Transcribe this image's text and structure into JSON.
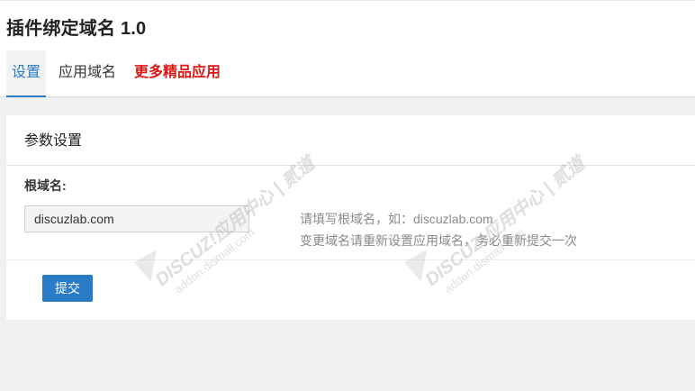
{
  "page": {
    "title": "插件绑定域名 1.0"
  },
  "tabs": [
    {
      "label": "设置",
      "active": true
    },
    {
      "label": "应用域名",
      "active": false
    },
    {
      "label": "更多精品应用",
      "active": false,
      "color": "#e01515"
    }
  ],
  "panel": {
    "heading": "参数设置",
    "field_label": "根域名:",
    "field_value": "discuzlab.com",
    "help_line1": "请填写根域名，如：discuzlab.com",
    "help_line2": "变更域名请重新设置应用域名，务必重新提交一次",
    "submit_label": "提交"
  },
  "watermark": {
    "brand": "DISCUZ!应用中心 | 贰道",
    "site": "addon.dismall.com"
  },
  "colors": {
    "accent": "#2a7bc8",
    "promo": "#e01515"
  }
}
